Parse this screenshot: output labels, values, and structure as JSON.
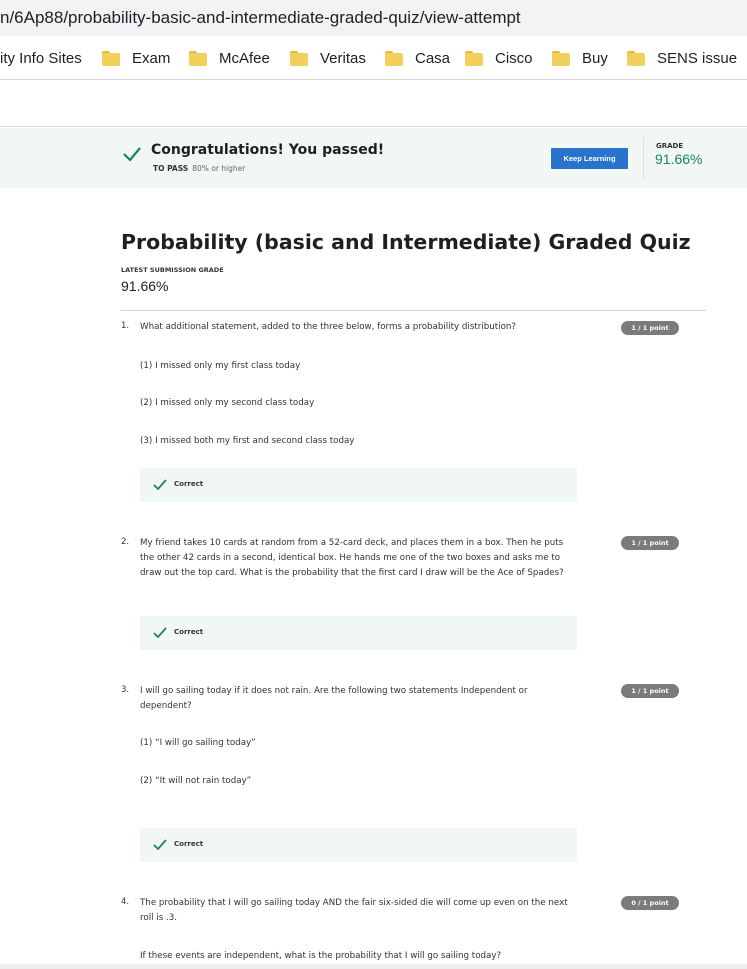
{
  "browser": {
    "url": "n/6Ap88/probability-basic-and-intermediate-graded-quiz/view-attempt",
    "bookmarks": [
      {
        "label": "ity Info Sites",
        "folder": false
      },
      {
        "label": "Exam",
        "folder": true
      },
      {
        "label": "McAfee",
        "folder": true
      },
      {
        "label": "Veritas",
        "folder": true
      },
      {
        "label": "Casa",
        "folder": true
      },
      {
        "label": "Cisco",
        "folder": true
      },
      {
        "label": "Buy",
        "folder": true
      },
      {
        "label": "SENS issue",
        "folder": true
      }
    ]
  },
  "banner": {
    "message": "Congratulations! You passed!",
    "to_pass_label": "TO PASS",
    "to_pass_value": "80% or higher",
    "keep_learning_label": "Keep Learning",
    "grade_label": "GRADE",
    "grade_value": "91.66%"
  },
  "quiz": {
    "title": "Probability (basic and Intermediate) Graded Quiz",
    "latest_label": "LATEST SUBMISSION GRADE",
    "latest_value": "91.66%",
    "questions": [
      {
        "number": "1.",
        "text": "What additional statement, added to the three below, forms a probability distribution?",
        "points": "1 / 1 point",
        "options": [
          "(1) I missed only my first class today",
          "(2) I missed only my second class today",
          "(3) I missed both my first and second class today"
        ],
        "feedback": "Correct"
      },
      {
        "number": "2.",
        "text": "My friend takes 10 cards at random from a 52-card deck, and places them in a box. Then he puts the other 42 cards in a second, identical box. He hands me one of the two boxes and asks me to draw out the top card. What is the probability that the first card I draw will be the Ace of Spades?",
        "points": "1 / 1 point",
        "feedback": "Correct"
      },
      {
        "number": "3.",
        "text": "I will go sailing today if it does not rain. Are the following two statements Independent or dependent?",
        "points": "1 / 1 point",
        "options": [
          "(1) “I will go sailing today”",
          "(2) “It will not rain today”"
        ],
        "feedback": "Correct"
      },
      {
        "number": "4.",
        "text": "The probability that I will go sailing today AND the fair six-sided die will come up even on the next roll is .3.",
        "points": "0 / 1 point",
        "followup": "If these events are independent, what is the probability that I will go sailing today?"
      }
    ]
  },
  "colors": {
    "banner_bg": "#f0f7f4",
    "success_green": "#1f8354",
    "button_blue": "#2a73cc",
    "points_pill": "#7b7b7b"
  }
}
